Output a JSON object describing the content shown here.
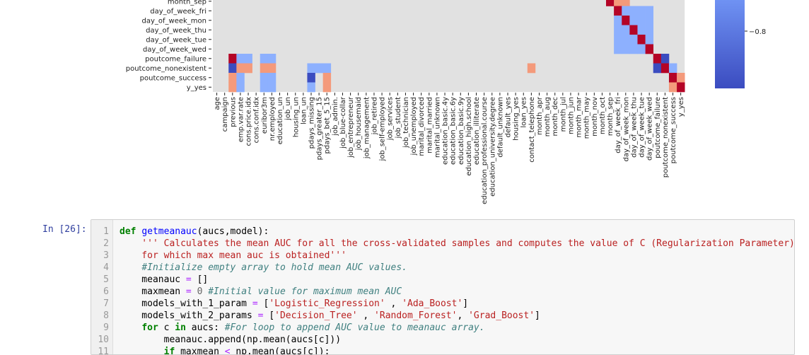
{
  "heatmap": {
    "row_labels": [
      "month_sep",
      "day_of_week_fri",
      "day_of_week_mon",
      "day_of_week_thu",
      "day_of_week_tue",
      "day_of_week_wed",
      "poutcome_failure",
      "poutcome_nonexistent",
      "poutcome_success",
      "y_yes"
    ],
    "col_labels": [
      "age",
      "campaign",
      "previous",
      "emp.var.rate",
      "cons.price.idx",
      "cons.conf.idx",
      "euribor3m",
      "nr.employed",
      "education_un",
      "job_un",
      "housing_un",
      "loan_un",
      "pdays_missing",
      "pdays_greater_15",
      "pdays_bet_5_15",
      "job_admin.",
      "job_blue-collar",
      "job_entrepreneur",
      "job_housemaid",
      "job_management",
      "job_retired",
      "job_self-employed",
      "job_services",
      "job_student",
      "job_technician",
      "job_unemployed",
      "marital_divorced",
      "marital_married",
      "marital_unknown",
      "education_basic.4y",
      "education_basic.6y",
      "education_basic.9y",
      "education_high.school",
      "education_illiterate",
      "education_professional.course",
      "education_university.degree",
      "default_unknown",
      "default_yes",
      "housing_yes",
      "loan_yes",
      "contact_telephone",
      "month_apr",
      "month_aug",
      "month_dec",
      "month_jul",
      "month_jun",
      "month_mar",
      "month_may",
      "month_nov",
      "month_oct",
      "month_sep",
      "day_of_week_fri",
      "day_of_week_mon",
      "day_of_week_thu",
      "day_of_week_tue",
      "day_of_week_wed",
      "poutcome_failure",
      "poutcome_nonexistent",
      "poutcome_success",
      "y_yes"
    ],
    "colorbar_tick": "−0.8",
    "colors": {
      "strong_neg": "#3b4cc0",
      "neg": "#8db0fe",
      "neutral": "#dddddd",
      "pos": "#f49a7b",
      "strong_pos": "#b40426"
    }
  },
  "cell": {
    "prompt": "In [26]:",
    "lines": [
      {
        "n": "1",
        "text": "def getmeanauc(aucs,model):"
      },
      {
        "n": "2",
        "text": "    ''' Calculates the mean AUC for all the cross-validated samples and computes the value of C (Regularization Parameter)"
      },
      {
        "n": "3",
        "text": "    for which max mean auc is obtained'''"
      },
      {
        "n": "4",
        "text": "    #Initialize empty array to hold mean AUC values."
      },
      {
        "n": "5",
        "text": "    meanauc = []"
      },
      {
        "n": "6",
        "text": "    maxmean = 0 #Initial value for maximum mean AUC"
      },
      {
        "n": "7",
        "text": "    models_with_1_param = ['Logistic_Regression' , 'Ada_Boost']"
      },
      {
        "n": "8",
        "text": "    models_with_2_params = ['Decision_Tree' , 'Random_Forest', 'Grad_Boost']"
      },
      {
        "n": "9",
        "text": "    for c in aucs: #For loop to append AUC value to meanauc array."
      },
      {
        "n": "10",
        "text": "        meanauc.append(np.mean(aucs[c]))"
      },
      {
        "n": "11",
        "text": "        if maxmean < np.mean(aucs[c]):"
      }
    ]
  }
}
